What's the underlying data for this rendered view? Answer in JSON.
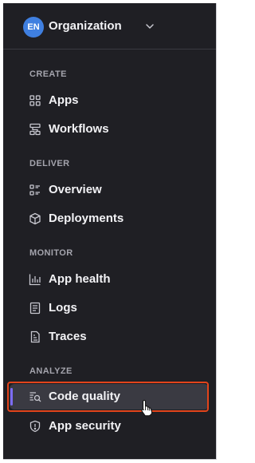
{
  "org": {
    "avatar_initials": "EN",
    "name": "Organization",
    "chevron_icon": "chevron-down-icon"
  },
  "sections": [
    {
      "heading": "CREATE",
      "items": [
        {
          "label": "Apps",
          "icon": "apps-grid-icon"
        },
        {
          "label": "Workflows",
          "icon": "workflows-icon"
        }
      ]
    },
    {
      "heading": "DELIVER",
      "items": [
        {
          "label": "Overview",
          "icon": "overview-icon"
        },
        {
          "label": "Deployments",
          "icon": "deployments-cube-icon"
        }
      ]
    },
    {
      "heading": "MONITOR",
      "items": [
        {
          "label": "App health",
          "icon": "bar-chart-icon"
        },
        {
          "label": "Logs",
          "icon": "logs-document-icon"
        },
        {
          "label": "Traces",
          "icon": "traces-document-icon"
        }
      ]
    },
    {
      "heading": "ANALYZE",
      "items": [
        {
          "label": "Code quality",
          "icon": "code-quality-search-icon",
          "active": true
        },
        {
          "label": "App security",
          "icon": "shield-alert-icon"
        }
      ]
    }
  ],
  "colors": {
    "sidebar_bg": "#1f1f24",
    "active_bg": "#3a3a42",
    "active_indicator": "#7c6cf5",
    "highlight_border": "#e2441b",
    "avatar_bg": "#3f7fe0"
  },
  "pointer": "hand-pointer-cursor-icon"
}
